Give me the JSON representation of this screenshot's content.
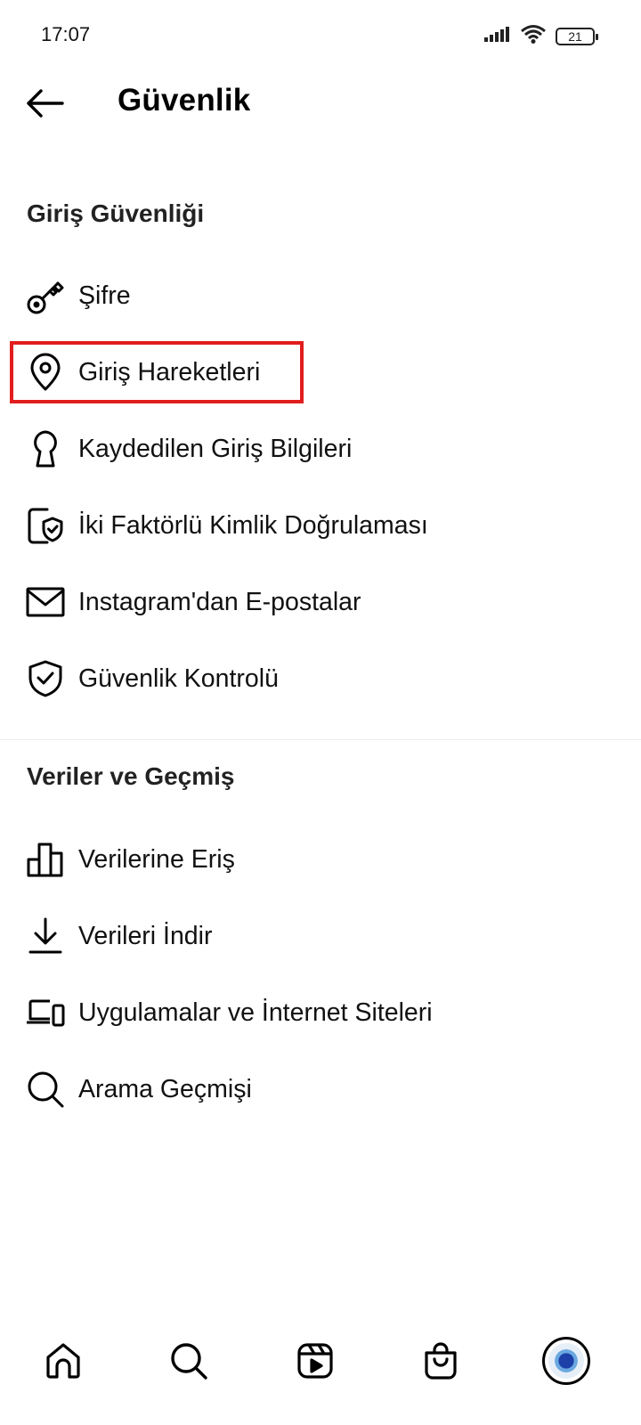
{
  "status_bar": {
    "time": "17:07",
    "battery": "21",
    "icons": [
      "signal-icon",
      "wifi-icon",
      "battery-icon"
    ]
  },
  "header": {
    "title": "Güvenlik",
    "back_icon": "arrow-left-icon"
  },
  "sections": [
    {
      "title": "Giriş Güvenliği",
      "items": [
        {
          "label": "Şifre",
          "icon": "key-icon"
        },
        {
          "label": "Giriş Hareketleri",
          "icon": "location-pin-icon",
          "highlighted": true
        },
        {
          "label": "Kaydedilen Giriş Bilgileri",
          "icon": "keyhole-icon"
        },
        {
          "label": "İki Faktörlü Kimlik Doğrulaması",
          "icon": "phone-shield-icon"
        },
        {
          "label": "Instagram'dan E-postalar",
          "icon": "mail-icon"
        },
        {
          "label": "Güvenlik Kontrolü",
          "icon": "shield-check-icon"
        }
      ]
    },
    {
      "title": "Veriler ve Geçmiş",
      "items": [
        {
          "label": "Verilerine Eriş",
          "icon": "bar-chart-icon"
        },
        {
          "label": "Verileri İndir",
          "icon": "download-icon"
        },
        {
          "label": "Uygulamalar ve İnternet Siteleri",
          "icon": "devices-icon"
        },
        {
          "label": "Arama Geçmişi",
          "icon": "search-icon"
        }
      ]
    }
  ],
  "bottom_nav": [
    "home-icon",
    "search-icon",
    "reels-icon",
    "shop-icon",
    "profile-avatar"
  ],
  "colors": {
    "highlight": "#e11d1d",
    "text": "#111111",
    "background": "#ffffff"
  }
}
